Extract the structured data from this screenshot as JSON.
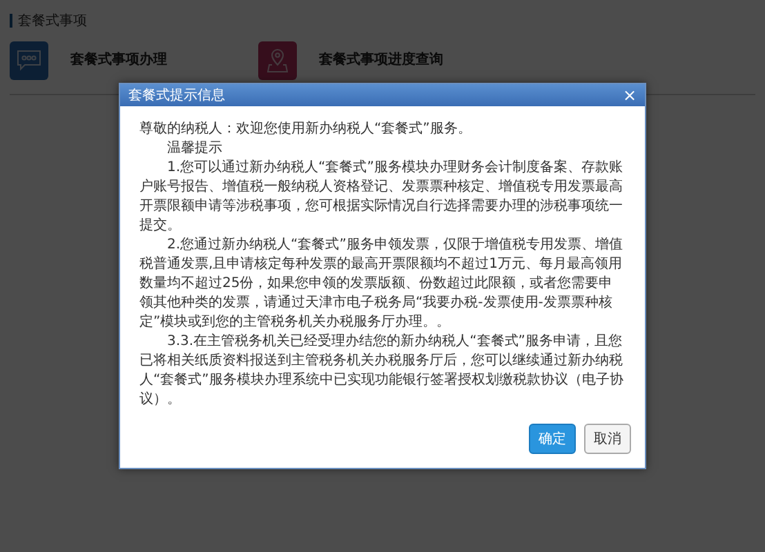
{
  "section": {
    "title": "套餐式事项"
  },
  "tiles": [
    {
      "kind": "chat",
      "label": "套餐式事项办理"
    },
    {
      "kind": "pin",
      "label": "套餐式事项进度查询"
    }
  ],
  "dialog": {
    "title": "套餐式提示信息",
    "close": "×",
    "paragraphs": [
      {
        "kind": "plain",
        "text": "尊敬的纳税人：欢迎您使用新办纳税人“套餐式”服务。"
      },
      {
        "kind": "indent",
        "text": "温馨提示"
      },
      {
        "kind": "indent",
        "text": "1.您可以通过新办纳税人“套餐式”服务模块办理财务会计制度备案、存款账户账号报告、增值税一般纳税人资格登记、发票票种核定、增值税专用发票最高开票限额申请等涉税事项，您可根据实际情况自行选择需要办理的涉税事项统一提交。"
      },
      {
        "kind": "indent",
        "text": "2.您通过新办纳税人“套餐式”服务申领发票，仅限于增值税专用发票、增值税普通发票,且申请核定每种发票的最高开票限额均不超过1万元、每月最高领用数量均不超过25份，如果您申领的发票版额、份数超过此限额，或者您需要申领其他种类的发票，请通过天津市电子税务局“我要办税-发票使用-发票票种核定”模块或到您的主管税务机关办税服务厅办理。。"
      },
      {
        "kind": "indent",
        "text": "3.3.在主管税务机关已经受理办结您的新办纳税人“套餐式”服务申请，且您已将相关纸质资料报送到主管税务机关办税服务厅后，您可以继续通过新办纳税人“套餐式”服务模块办理系统中已实现功能银行签署授权划缴税款协议（电子协议）。"
      }
    ],
    "buttons": [
      {
        "kind": "primary",
        "label": "确定"
      },
      {
        "kind": "secondary",
        "label": "取消"
      }
    ]
  }
}
